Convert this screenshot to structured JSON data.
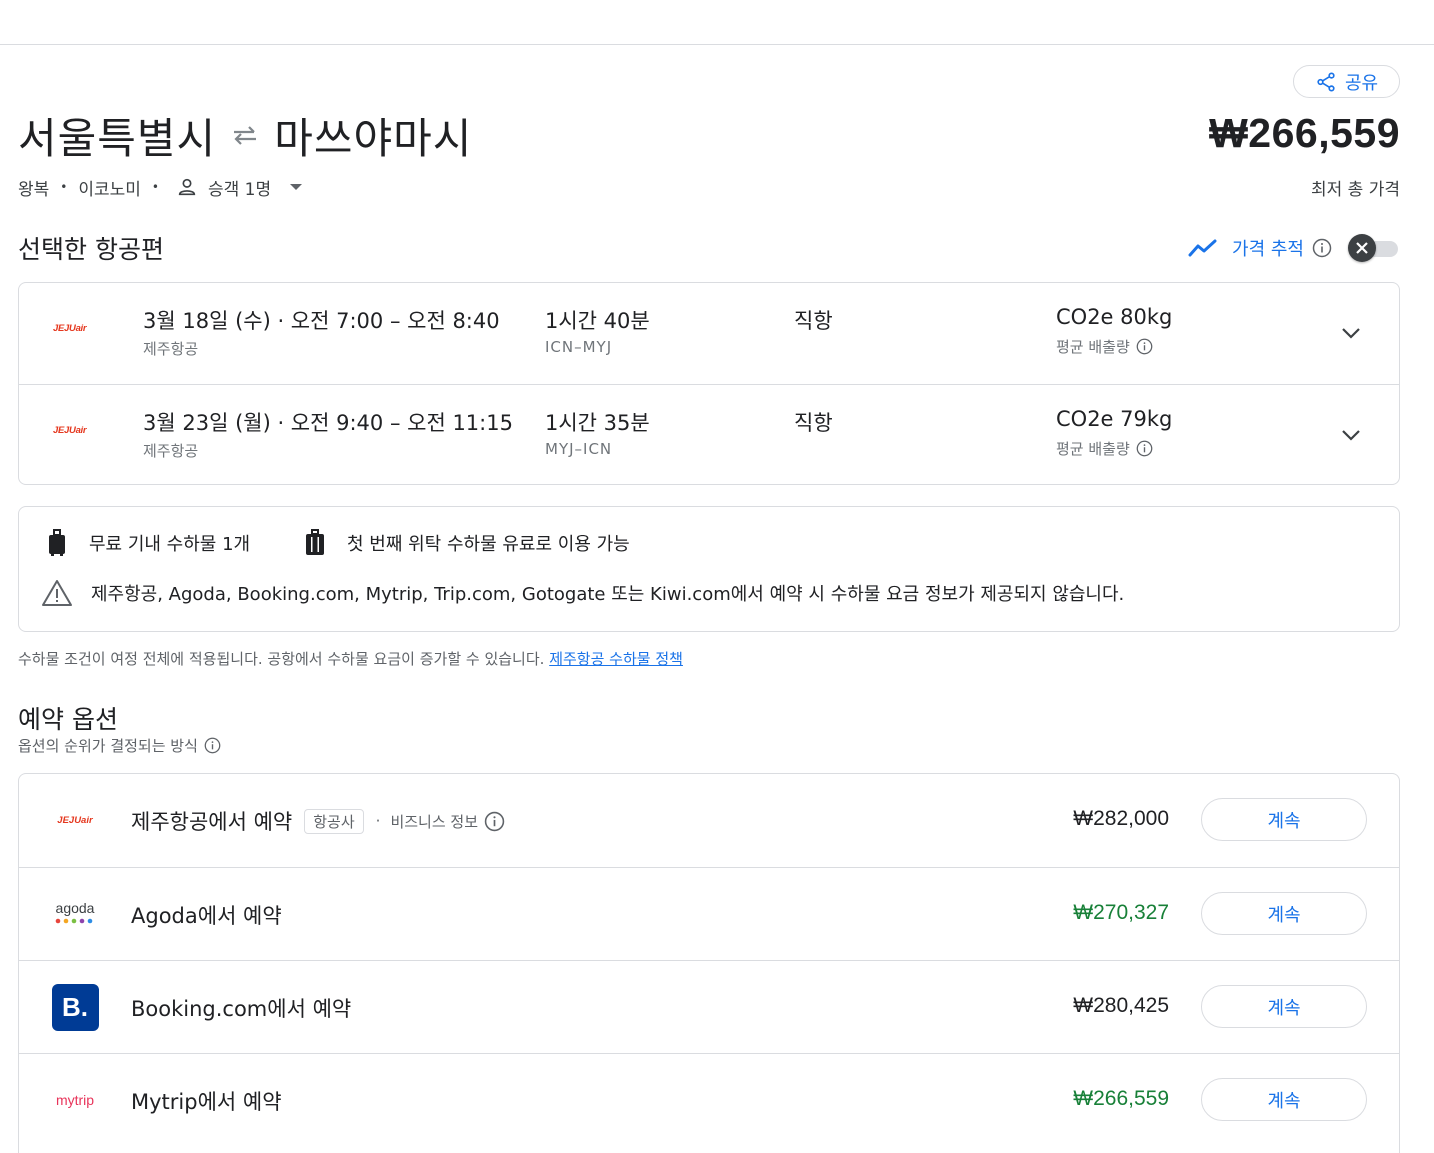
{
  "header": {
    "share_label": "공유",
    "origin": "서울특별시",
    "destination": "마쓰야마시",
    "total_price": "₩266,559",
    "total_price_label": "최저 총 가격"
  },
  "trip_meta": {
    "trip_type": "왕복",
    "cabin_class": "이코노미",
    "passengers": "승객 1명"
  },
  "selected_flights": {
    "title": "선택한 항공편",
    "price_tracking_label": "가격 추적",
    "flights": [
      {
        "airline_logo": "JEJUair",
        "times": "3월 18일 (수) · 오전 7:00 – 오전 8:40",
        "airline": "제주항공",
        "duration": "1시간 40분",
        "route": "ICN–MYJ",
        "stops": "직항",
        "co2": "CO2e 80kg",
        "co2_label": "평균 배출량"
      },
      {
        "airline_logo": "JEJUair",
        "times": "3월 23일 (월) · 오전 9:40 – 오전 11:15",
        "airline": "제주항공",
        "duration": "1시간 35분",
        "route": "MYJ–ICN",
        "stops": "직항",
        "co2": "CO2e 79kg",
        "co2_label": "평균 배출량"
      }
    ]
  },
  "baggage": {
    "carry_on": "무료 기내 수하물 1개",
    "checked": "첫 번째 위탁 수하물 유료로 이용 가능",
    "warning": "제주항공, Agoda, Booking.com, Mytrip, Trip.com, Gotogate 또는 Kiwi.com에서 예약 시 수하물 요금 정보가 제공되지 않습니다.",
    "note": "수하물 조건이 여정 전체에 적용됩니다. 공항에서 수하물 요금이 증가할 수 있습니다.",
    "policy_link": "제주항공 수하물 정책"
  },
  "booking": {
    "title": "예약 옵션",
    "subtitle": "옵션의 순위가 결정되는 방식",
    "options": [
      {
        "logo": "JEJUair",
        "name": "제주항공에서 예약",
        "chip": "항공사",
        "biz": "비즈니스 정보",
        "price": "₩282,000",
        "price_color": "#202124",
        "button": "계속"
      },
      {
        "logo": "agoda",
        "name": "Agoda에서 예약",
        "price": "₩270,327",
        "price_color": "#188038",
        "button": "계속"
      },
      {
        "logo": "B.",
        "name": "Booking.com에서 예약",
        "price": "₩280,425",
        "price_color": "#202124",
        "button": "계속"
      },
      {
        "logo": "mytrip",
        "name": "Mytrip에서 예약",
        "price": "₩266,559",
        "price_color": "#188038",
        "button": "계속"
      }
    ]
  },
  "colors": {
    "accent": "#1a73e8",
    "good_price": "#188038",
    "jeju_red": "#e5381f",
    "booking_blue": "#003b95"
  }
}
